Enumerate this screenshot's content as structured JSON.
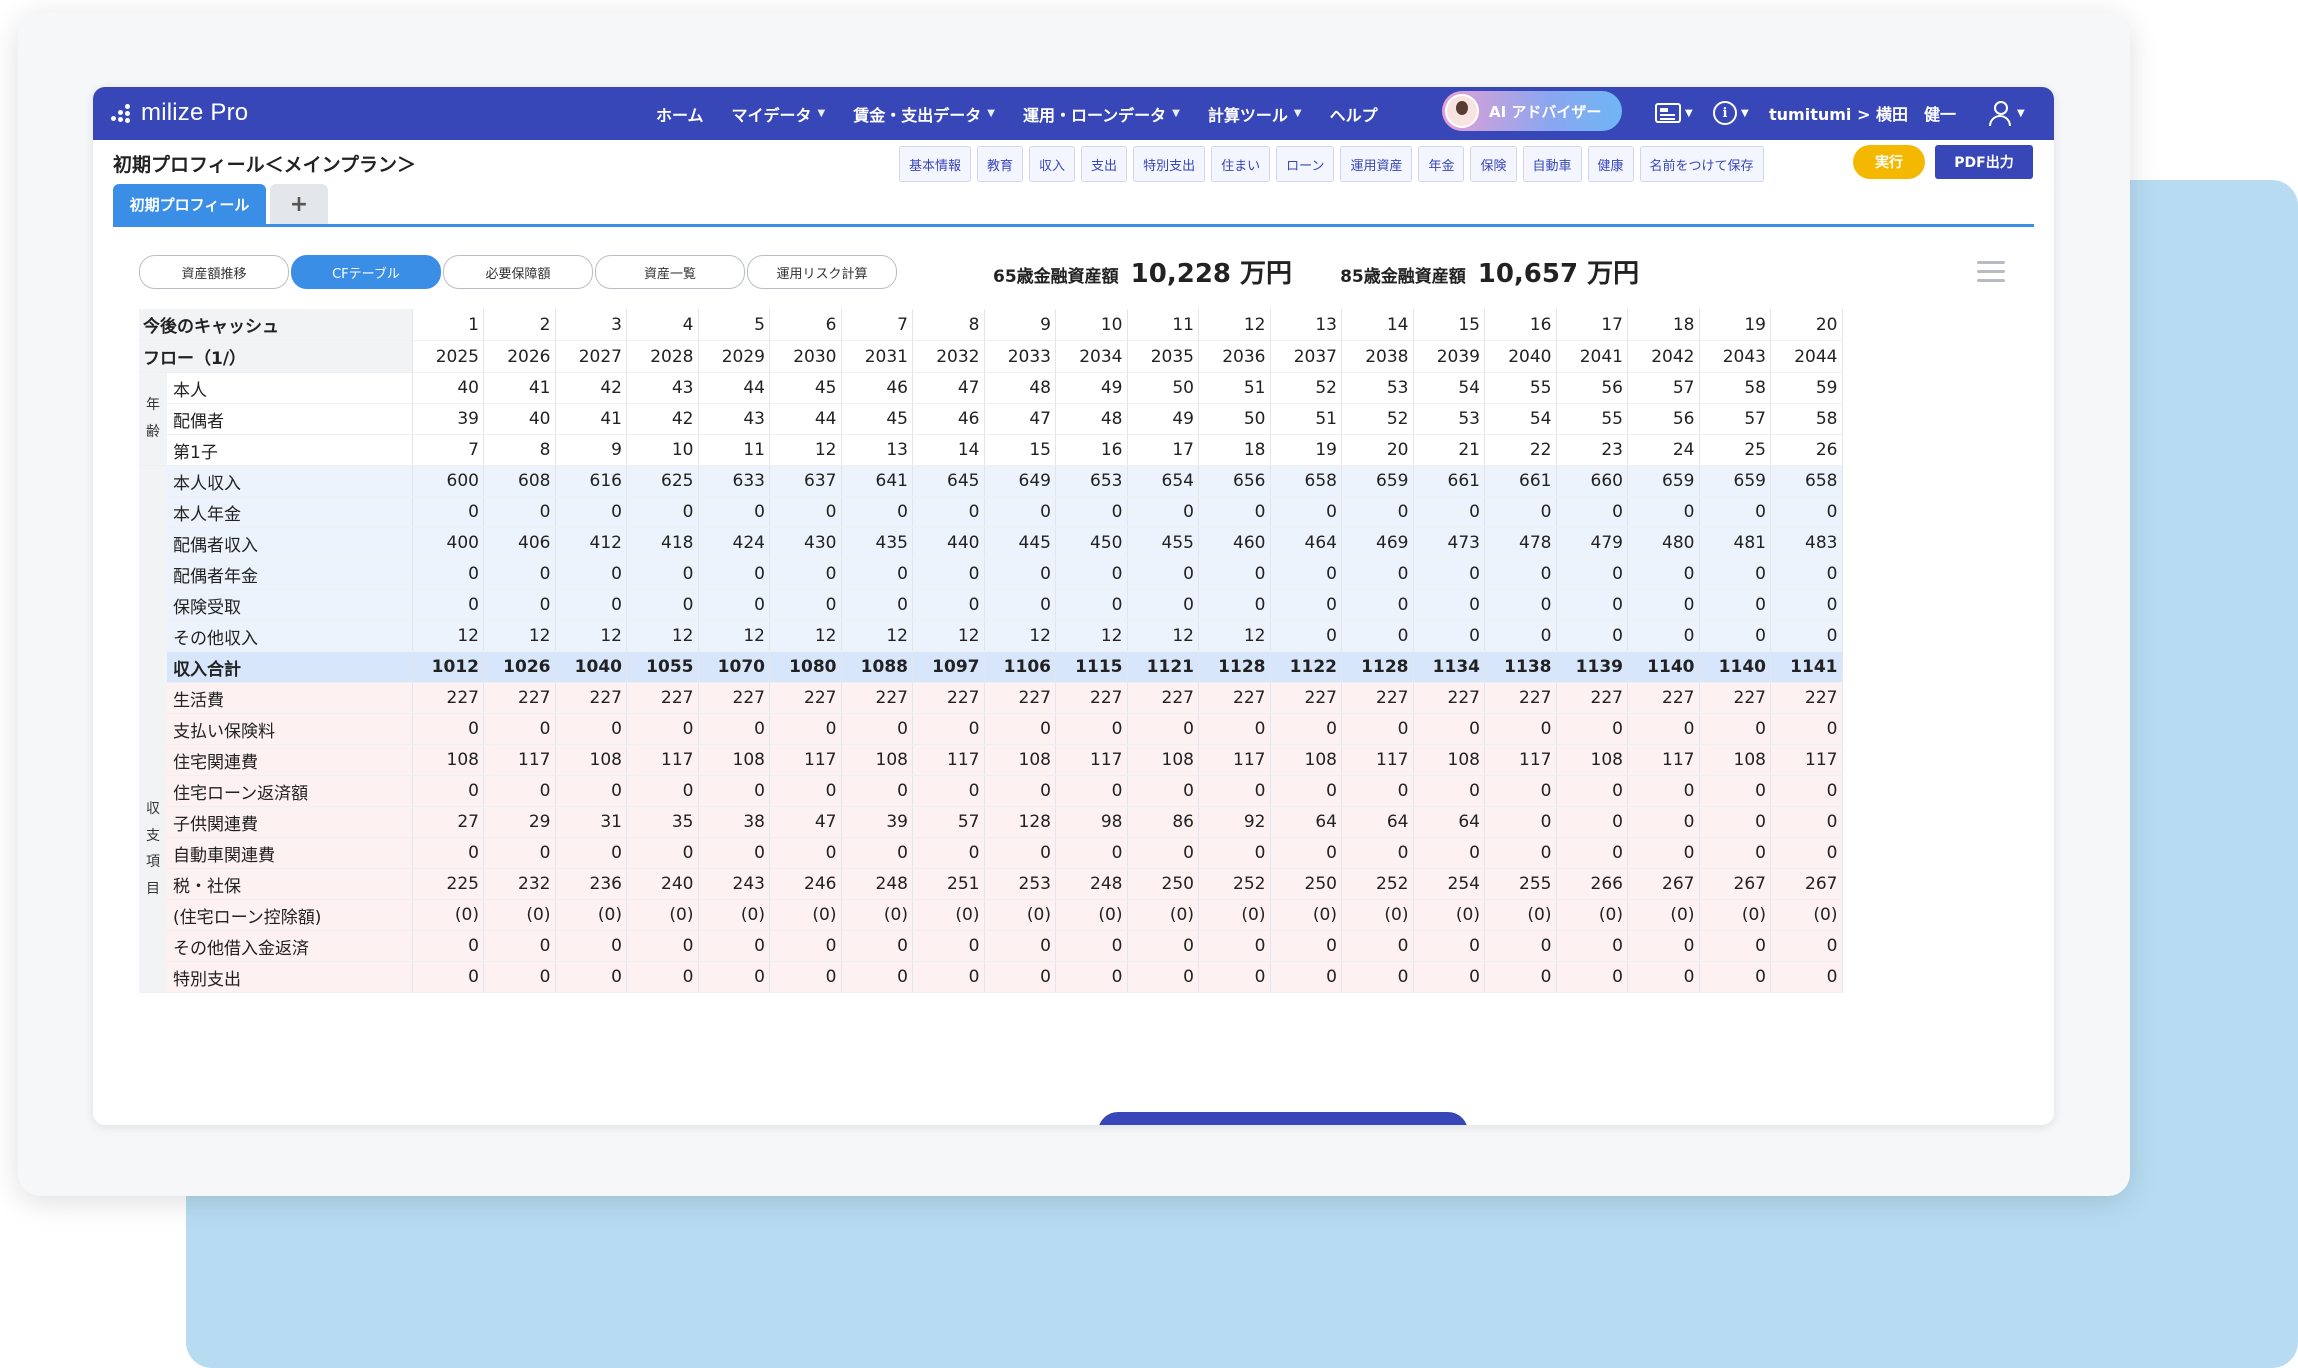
{
  "logo": {
    "text": "milize Pro"
  },
  "nav": {
    "items": [
      {
        "label": "ホーム",
        "caret": false
      },
      {
        "label": "マイデータ",
        "caret": true
      },
      {
        "label": "賃金・支出データ",
        "caret": true
      },
      {
        "label": "運用・ローンデータ",
        "caret": true
      },
      {
        "label": "計算ツール",
        "caret": true
      },
      {
        "label": "ヘルプ",
        "caret": false
      }
    ],
    "ai_button": "AI アドバイザー",
    "user": "tumitumi > 横田　健一"
  },
  "page": {
    "title": "初期プロフィール＜メインプラン＞"
  },
  "quick_buttons": [
    "基本情報",
    "教育",
    "収入",
    "支出",
    "特別支出",
    "住まい",
    "ローン",
    "運用資産",
    "年金",
    "保険",
    "自動車",
    "健康",
    "名前をつけて保存"
  ],
  "actions": {
    "run": "実行",
    "pdf": "PDF出力"
  },
  "tabs": {
    "active": "初期プロフィール",
    "add": "+"
  },
  "segments": [
    {
      "label": "資産額推移",
      "active": false
    },
    {
      "label": "CFテーブル",
      "active": true
    },
    {
      "label": "必要保障額",
      "active": false
    },
    {
      "label": "資産一覧",
      "active": false
    },
    {
      "label": "運用リスク計算",
      "active": false
    }
  ],
  "summary": {
    "label65": "65歳金融資産額",
    "value65": "10,228 万円",
    "label85": "85歳金融資産額",
    "value85": "10,657 万円"
  },
  "table": {
    "header_line1": "今後のキャッシュ",
    "header_line2": "フロー（1/）",
    "index": [
      "1",
      "2",
      "3",
      "4",
      "5",
      "6",
      "7",
      "8",
      "9",
      "10",
      "11",
      "12",
      "13",
      "14",
      "15",
      "16",
      "17",
      "18",
      "19",
      "20"
    ],
    "years": [
      "2025",
      "2026",
      "2027",
      "2028",
      "2029",
      "2030",
      "2031",
      "2032",
      "2033",
      "2034",
      "2035",
      "2036",
      "2037",
      "2038",
      "2039",
      "2040",
      "2041",
      "2042",
      "2043",
      "2044"
    ],
    "group_age": "年齢",
    "group_items": "収支項目",
    "rows": [
      {
        "label": "本人",
        "kind": "age",
        "values": [
          "40",
          "41",
          "42",
          "43",
          "44",
          "45",
          "46",
          "47",
          "48",
          "49",
          "50",
          "51",
          "52",
          "53",
          "54",
          "55",
          "56",
          "57",
          "58",
          "59"
        ]
      },
      {
        "label": "配偶者",
        "kind": "age",
        "values": [
          "39",
          "40",
          "41",
          "42",
          "43",
          "44",
          "45",
          "46",
          "47",
          "48",
          "49",
          "50",
          "51",
          "52",
          "53",
          "54",
          "55",
          "56",
          "57",
          "58"
        ]
      },
      {
        "label": "第1子",
        "kind": "age",
        "values": [
          "7",
          "8",
          "9",
          "10",
          "11",
          "12",
          "13",
          "14",
          "15",
          "16",
          "17",
          "18",
          "19",
          "20",
          "21",
          "22",
          "23",
          "24",
          "25",
          "26"
        ]
      },
      {
        "label": "本人収入",
        "kind": "inc",
        "values": [
          "600",
          "608",
          "616",
          "625",
          "633",
          "637",
          "641",
          "645",
          "649",
          "653",
          "654",
          "656",
          "658",
          "659",
          "661",
          "661",
          "660",
          "659",
          "659",
          "658"
        ]
      },
      {
        "label": "本人年金",
        "kind": "inc",
        "values": [
          "0",
          "0",
          "0",
          "0",
          "0",
          "0",
          "0",
          "0",
          "0",
          "0",
          "0",
          "0",
          "0",
          "0",
          "0",
          "0",
          "0",
          "0",
          "0",
          "0"
        ]
      },
      {
        "label": "配偶者収入",
        "kind": "inc",
        "values": [
          "400",
          "406",
          "412",
          "418",
          "424",
          "430",
          "435",
          "440",
          "445",
          "450",
          "455",
          "460",
          "464",
          "469",
          "473",
          "478",
          "479",
          "480",
          "481",
          "483"
        ]
      },
      {
        "label": "配偶者年金",
        "kind": "inc",
        "values": [
          "0",
          "0",
          "0",
          "0",
          "0",
          "0",
          "0",
          "0",
          "0",
          "0",
          "0",
          "0",
          "0",
          "0",
          "0",
          "0",
          "0",
          "0",
          "0",
          "0"
        ]
      },
      {
        "label": "保険受取",
        "kind": "inc",
        "values": [
          "0",
          "0",
          "0",
          "0",
          "0",
          "0",
          "0",
          "0",
          "0",
          "0",
          "0",
          "0",
          "0",
          "0",
          "0",
          "0",
          "0",
          "0",
          "0",
          "0"
        ]
      },
      {
        "label": "その他収入",
        "kind": "inc",
        "values": [
          "12",
          "12",
          "12",
          "12",
          "12",
          "12",
          "12",
          "12",
          "12",
          "12",
          "12",
          "12",
          "0",
          "0",
          "0",
          "0",
          "0",
          "0",
          "0",
          "0"
        ]
      },
      {
        "label": "収入合計",
        "kind": "total",
        "values": [
          "1012",
          "1026",
          "1040",
          "1055",
          "1070",
          "1080",
          "1088",
          "1097",
          "1106",
          "1115",
          "1121",
          "1128",
          "1122",
          "1128",
          "1134",
          "1138",
          "1139",
          "1140",
          "1140",
          "1141"
        ]
      },
      {
        "label": "生活費",
        "kind": "exp",
        "values": [
          "227",
          "227",
          "227",
          "227",
          "227",
          "227",
          "227",
          "227",
          "227",
          "227",
          "227",
          "227",
          "227",
          "227",
          "227",
          "227",
          "227",
          "227",
          "227",
          "227"
        ]
      },
      {
        "label": "支払い保険料",
        "kind": "exp",
        "values": [
          "0",
          "0",
          "0",
          "0",
          "0",
          "0",
          "0",
          "0",
          "0",
          "0",
          "0",
          "0",
          "0",
          "0",
          "0",
          "0",
          "0",
          "0",
          "0",
          "0"
        ]
      },
      {
        "label": "住宅関連費",
        "kind": "exp",
        "values": [
          "108",
          "117",
          "108",
          "117",
          "108",
          "117",
          "108",
          "117",
          "108",
          "117",
          "108",
          "117",
          "108",
          "117",
          "108",
          "117",
          "108",
          "117",
          "108",
          "117"
        ]
      },
      {
        "label": "住宅ローン返済額",
        "kind": "exp",
        "values": [
          "0",
          "0",
          "0",
          "0",
          "0",
          "0",
          "0",
          "0",
          "0",
          "0",
          "0",
          "0",
          "0",
          "0",
          "0",
          "0",
          "0",
          "0",
          "0",
          "0"
        ]
      },
      {
        "label": "子供関連費",
        "kind": "exp",
        "values": [
          "27",
          "29",
          "31",
          "35",
          "38",
          "47",
          "39",
          "57",
          "128",
          "98",
          "86",
          "92",
          "64",
          "64",
          "64",
          "0",
          "0",
          "0",
          "0",
          "0"
        ]
      },
      {
        "label": "自動車関連費",
        "kind": "exp",
        "values": [
          "0",
          "0",
          "0",
          "0",
          "0",
          "0",
          "0",
          "0",
          "0",
          "0",
          "0",
          "0",
          "0",
          "0",
          "0",
          "0",
          "0",
          "0",
          "0",
          "0"
        ]
      },
      {
        "label": "税・社保",
        "kind": "exp",
        "values": [
          "225",
          "232",
          "236",
          "240",
          "243",
          "246",
          "248",
          "251",
          "253",
          "248",
          "250",
          "252",
          "250",
          "252",
          "254",
          "255",
          "266",
          "267",
          "267",
          "267"
        ]
      },
      {
        "label": "(住宅ローン控除額)",
        "kind": "exp",
        "values": [
          "(0)",
          "(0)",
          "(0)",
          "(0)",
          "(0)",
          "(0)",
          "(0)",
          "(0)",
          "(0)",
          "(0)",
          "(0)",
          "(0)",
          "(0)",
          "(0)",
          "(0)",
          "(0)",
          "(0)",
          "(0)",
          "(0)",
          "(0)"
        ]
      },
      {
        "label": "その他借入金返済",
        "kind": "exp",
        "values": [
          "0",
          "0",
          "0",
          "0",
          "0",
          "0",
          "0",
          "0",
          "0",
          "0",
          "0",
          "0",
          "0",
          "0",
          "0",
          "0",
          "0",
          "0",
          "0",
          "0"
        ]
      },
      {
        "label": "特別支出",
        "kind": "exp",
        "values": [
          "0",
          "0",
          "0",
          "0",
          "0",
          "0",
          "0",
          "0",
          "0",
          "0",
          "0",
          "0",
          "0",
          "0",
          "0",
          "0",
          "0",
          "0",
          "0",
          "0"
        ]
      }
    ]
  },
  "colors": {
    "header_bg": "#3847b8",
    "accent": "#3a8ee6",
    "run": "#f5b800",
    "bg_card": "#b7dcf2",
    "income_row": "#edf3fc",
    "total_row": "#d7e6fb",
    "expense_row": "#fdf1f1"
  }
}
